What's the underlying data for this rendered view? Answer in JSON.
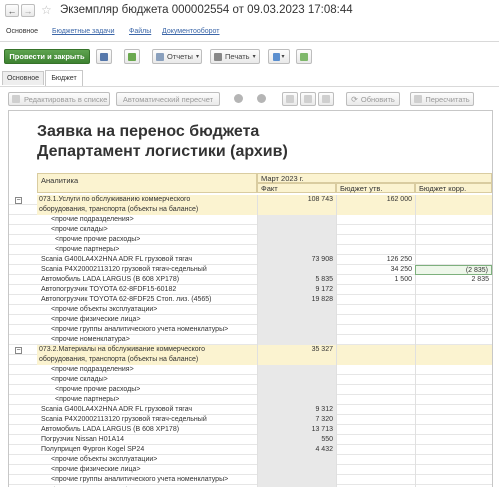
{
  "window": {
    "title": "Экземпляр бюджета 000002554 от 09.03.2023 17:08:44"
  },
  "nav_tabs": [
    "Основное",
    "Бюджетные задачи",
    "Файлы",
    "Документооборот"
  ],
  "toolbar": {
    "post_close": "Провести и закрыть",
    "reports": "Отчеты",
    "print": "Печать"
  },
  "tabs": [
    "Основное",
    "Бюджет"
  ],
  "report_toolbar": {
    "edit_in_list": "Редактировать в списке",
    "auto_recalc": "Автоматический пересчет",
    "refresh": "Обновить",
    "recalc": "Пересчитать"
  },
  "report": {
    "title1": "Заявка на перенос бюджета",
    "title2": "Департамент логистики (архив)",
    "col_analytics": "Аналитика",
    "period": "Март 2023 г.",
    "col_fact": "Факт",
    "col_budget": "Бюджет утв.",
    "col_budget_corr": "Бюджет корр.",
    "rows": [
      {
        "label": "073.1.Услуги по обслуживанию коммерческого",
        "fact": "108 743",
        "budget": "162 000",
        "corr": "",
        "type": "group"
      },
      {
        "label": "оборудования, транспорта (объекты на балансе)",
        "fact": "",
        "budget": "",
        "corr": "",
        "type": "group"
      },
      {
        "label": "<прочие подразделения>",
        "fact": "",
        "budget": "",
        "corr": "",
        "type": "i1"
      },
      {
        "label": "<прочие склады>",
        "fact": "",
        "budget": "",
        "corr": "",
        "type": "i2"
      },
      {
        "label": "<прочие прочие расходы>",
        "fact": "",
        "budget": "",
        "corr": "",
        "type": "i3"
      },
      {
        "label": "<прочие партнеры>",
        "fact": "",
        "budget": "",
        "corr": "",
        "type": "i3"
      },
      {
        "label": "Scania G400LA4X2HNA ADR FL грузовой тягач",
        "fact": "73 908",
        "budget": "126 250",
        "corr": "",
        "type": "item"
      },
      {
        "label": "Scania P4X20002113120 грузовой тягач-седельный",
        "fact": "",
        "budget": "34 250",
        "corr": "(2 835)",
        "type": "item",
        "sel": true
      },
      {
        "label": "Автомобиль LADA LARGUS  (B 608 XP178)",
        "fact": "5 835",
        "budget": "1 500",
        "corr": "2 835",
        "type": "item"
      },
      {
        "label": "Автопогрузчик TOYOTA 62-8FDF15-60182",
        "fact": "9 172",
        "budget": "",
        "corr": "",
        "type": "item"
      },
      {
        "label": "Автопогрузчик TOYOTA 62-8FDF25 Стоп. лиз. (4565)",
        "fact": "19 828",
        "budget": "",
        "corr": "",
        "type": "item"
      },
      {
        "label": "<прочие объекты эксплуатации>",
        "fact": "",
        "budget": "",
        "corr": "",
        "type": "i2"
      },
      {
        "label": "<прочие физические лица>",
        "fact": "",
        "budget": "",
        "corr": "",
        "type": "i2"
      },
      {
        "label": "<прочие группы аналитического учета номенклатуры>",
        "fact": "",
        "budget": "",
        "corr": "",
        "type": "i2"
      },
      {
        "label": "<прочие номенклатура>",
        "fact": "",
        "budget": "",
        "corr": "",
        "type": "i2"
      },
      {
        "label": "073.2.Материалы на обслуживание коммерческого",
        "fact": "35 327",
        "budget": "",
        "corr": "",
        "type": "group"
      },
      {
        "label": "оборудования, транспорта (объекты на балансе)",
        "fact": "",
        "budget": "",
        "corr": "",
        "type": "group"
      },
      {
        "label": "<прочие подразделения>",
        "fact": "",
        "budget": "",
        "corr": "",
        "type": "i1"
      },
      {
        "label": "<прочие склады>",
        "fact": "",
        "budget": "",
        "corr": "",
        "type": "i2"
      },
      {
        "label": "<прочие прочие расходы>",
        "fact": "",
        "budget": "",
        "corr": "",
        "type": "i3"
      },
      {
        "label": "<прочие партнеры>",
        "fact": "",
        "budget": "",
        "corr": "",
        "type": "i3"
      },
      {
        "label": "Scania G400LA4X2HNA ADR FL грузовой тягач",
        "fact": "9 312",
        "budget": "",
        "corr": "",
        "type": "item"
      },
      {
        "label": "Scania P4X20002113120 грузовой тягач-седельный",
        "fact": "7 320",
        "budget": "",
        "corr": "",
        "type": "item"
      },
      {
        "label": "Автомобиль LADA LARGUS  (B 608 XP178)",
        "fact": "13 713",
        "budget": "",
        "corr": "",
        "type": "item"
      },
      {
        "label": "Погрузчик Nissan H01A14",
        "fact": "550",
        "budget": "",
        "corr": "",
        "type": "item"
      },
      {
        "label": "Полуприцеп Фургон Kogel SP24",
        "fact": "4 432",
        "budget": "",
        "corr": "",
        "type": "item"
      },
      {
        "label": "<прочие объекты эксплуатации>",
        "fact": "",
        "budget": "",
        "corr": "",
        "type": "i2"
      },
      {
        "label": "<прочие физические лица>",
        "fact": "",
        "budget": "",
        "corr": "",
        "type": "i2"
      },
      {
        "label": "<прочие группы аналитического учета номенклатуры>",
        "fact": "",
        "budget": "",
        "corr": "",
        "type": "i2"
      },
      {
        "label": "<прочие номенклатура>",
        "fact": "",
        "budget": "",
        "corr": "",
        "type": "i2"
      }
    ]
  }
}
